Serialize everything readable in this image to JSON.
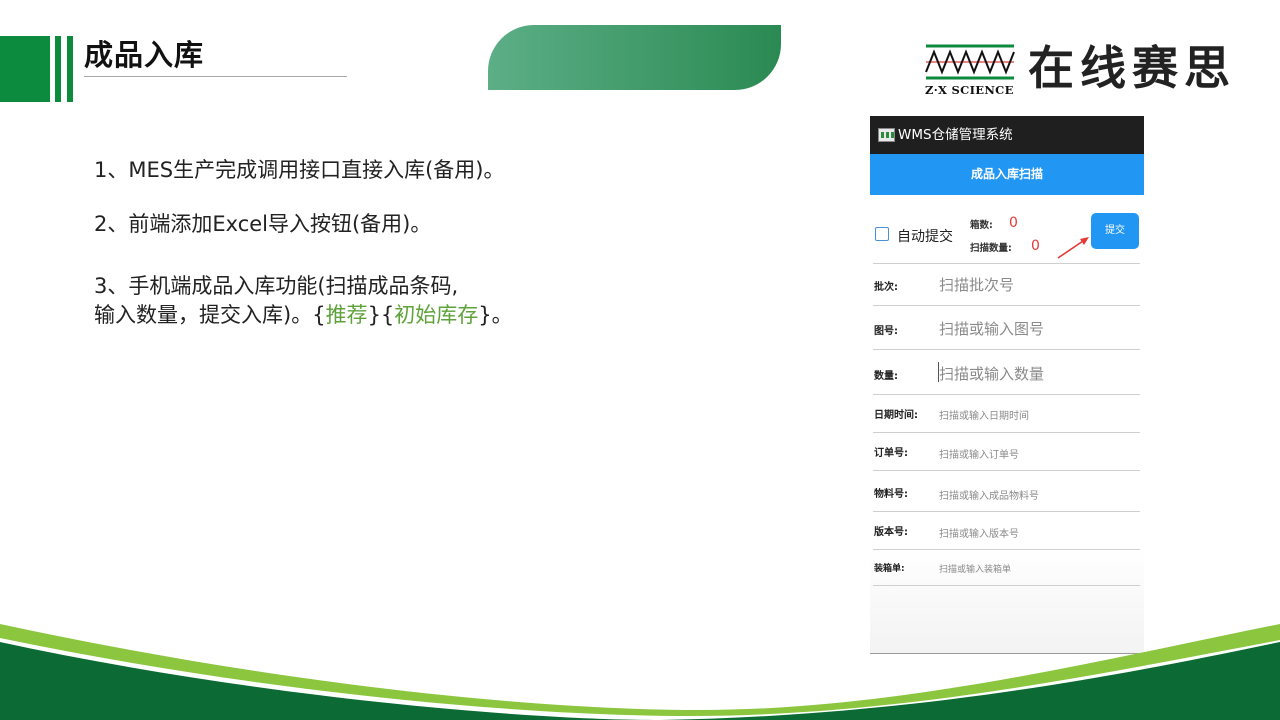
{
  "slide": {
    "title": "成品入库",
    "lines": {
      "l1": "1、MES生产完成调用接口直接入库(备用)。",
      "l2": "2、前端添加Excel导入按钮(备用)。",
      "l3a": "3、手机端成品入库功能(扫描成品条码,",
      "l3b_pre": "输入数量，提交入库)。{",
      "l3b_rec": "推荐",
      "l3b_mid": "}{",
      "l3b_init": "初始库存",
      "l3b_end": "}。"
    }
  },
  "logo": {
    "brand_cn": "在线赛思",
    "brand_en": "Z·X SCIENCE"
  },
  "phone": {
    "app_title": "WMS仓储管理系统",
    "screen_title": "成品入库扫描",
    "auto_submit_label": "自动提交",
    "box_count_label": "箱数:",
    "box_count_value": "0",
    "scan_qty_label": "扫描数量:",
    "scan_qty_value": "0",
    "submit_label": "提交",
    "fields": [
      {
        "label": "批次:",
        "placeholder": "扫描批次号"
      },
      {
        "label": "图号:",
        "placeholder": "扫描或输入图号"
      },
      {
        "label": "数量:",
        "placeholder": "扫描或输入数量"
      },
      {
        "label": "日期时间:",
        "placeholder": "扫描或输入日期时间"
      },
      {
        "label": "订单号:",
        "placeholder": "扫描或输入订单号"
      },
      {
        "label": "物料号:",
        "placeholder": "扫描或输入成品物料号"
      },
      {
        "label": "版本号:",
        "placeholder": "扫描或输入版本号"
      },
      {
        "label": "装箱单:",
        "placeholder": "扫描或输入装箱单"
      }
    ]
  },
  "colors": {
    "brand_green": "#0c8a3d",
    "accent_green": "#5ea23a",
    "primary_blue": "#2196f3",
    "count_red": "#e53935",
    "wave_light_green": "#8cc63f"
  }
}
